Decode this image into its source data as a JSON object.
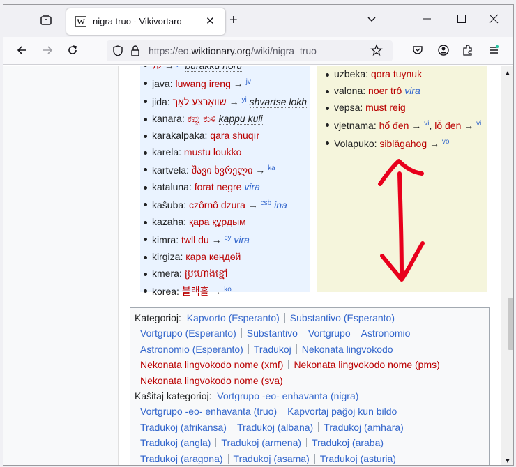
{
  "browser": {
    "tab_title": "nigra truo - Vikivortaro",
    "favicon_letter": "W",
    "url_prefix": "https://eo.",
    "url_domain": "wiktionary.org",
    "url_path": "/wiki/nigra_truo"
  },
  "translations_left": [
    {
      "lang": "",
      "word": "ル",
      "code": "ja",
      "translit": "burakku horu",
      "cut": true
    },
    {
      "lang": "java",
      "word": "luwang ireng",
      "code": "jv"
    },
    {
      "lang": "jida",
      "word": "שוואַרצע לאָך",
      "code": "yi",
      "translit": "shvartse lokh"
    },
    {
      "lang": "kanara",
      "word": "ಕಪ್ಪು ಕುಳಿ",
      "translit": "kappu kuli"
    },
    {
      "lang": "karakalpaka",
      "word": "qara shuqır"
    },
    {
      "lang": "karela",
      "word": "mustu loukko"
    },
    {
      "lang": "kartvela",
      "word": "შავი ხვრელი",
      "code": "ka"
    },
    {
      "lang": "kataluna",
      "word": "forat negre",
      "gender": "vira"
    },
    {
      "lang": "kaŝuba",
      "word": "czôrnô dzura",
      "code": "csb",
      "gender": "ina"
    },
    {
      "lang": "kazaha",
      "word": "қара құрдым"
    },
    {
      "lang": "kimra",
      "word": "twll du",
      "code": "cy",
      "gender": "vira"
    },
    {
      "lang": "kirgiza",
      "word": "кара көңдөй"
    },
    {
      "lang": "kmera",
      "word": "ប្រហោងខ្មៅ"
    },
    {
      "lang": "korea",
      "word": "블랙홀",
      "code": "ko"
    }
  ],
  "translations_right": [
    {
      "lang": "uzbeka",
      "word": "qora tuynuk"
    },
    {
      "lang": "valona",
      "word": "noer trô",
      "gender": "vira"
    },
    {
      "lang": "vepsa",
      "word": "must reig"
    },
    {
      "lang": "vjetnama",
      "word": "hố đen",
      "code": "vi",
      "word2": "lỗ đen",
      "code2": "vi"
    },
    {
      "lang": "Volapuko",
      "word": "siblägahog",
      "code": "vo"
    }
  ],
  "categories": {
    "label": "Kategorioj:",
    "lines": [
      [
        {
          "t": "Kapvorto (Esperanto)"
        },
        {
          "t": "Substantivo (Esperanto)"
        }
      ],
      [
        {
          "t": "Vortgrupo (Esperanto)"
        },
        {
          "t": "Substantivo"
        },
        {
          "t": "Vortgrupo"
        },
        {
          "t": "Astronomio"
        }
      ],
      [
        {
          "t": "Astronomio (Esperanto)"
        },
        {
          "t": "Tradukoj"
        },
        {
          "t": "Nekonata lingvokodo"
        }
      ],
      [
        {
          "t": "Nekonata lingvokodo nome (xmf)",
          "new": true
        },
        {
          "t": "Nekonata lingvokodo nome (pms)",
          "new": true
        }
      ],
      [
        {
          "t": "Nekonata lingvokodo nome (sva)",
          "new": true
        }
      ]
    ],
    "hidden_label": "Kaŝitaj kategorioj:",
    "hidden_lines": [
      [
        {
          "t": "Vortgrupo -eo- enhavanta (nigra)"
        }
      ],
      [
        {
          "t": "Vortgrupo -eo- enhavanta (truo)"
        },
        {
          "t": "Kapvortaj paĝoj kun bildo"
        }
      ],
      [
        {
          "t": "Tradukoj (afrikansa)"
        },
        {
          "t": "Tradukoj (albana)"
        },
        {
          "t": "Tradukoj (amhara)"
        }
      ],
      [
        {
          "t": "Tradukoj (angla)"
        },
        {
          "t": "Tradukoj (armena)"
        },
        {
          "t": "Tradukoj (araba)"
        }
      ],
      [
        {
          "t": "Tradukoj (aragona)"
        },
        {
          "t": "Tradukoj (asama)"
        },
        {
          "t": "Tradukoj (asturia)"
        }
      ]
    ]
  },
  "annotation_color": "#e8001c"
}
